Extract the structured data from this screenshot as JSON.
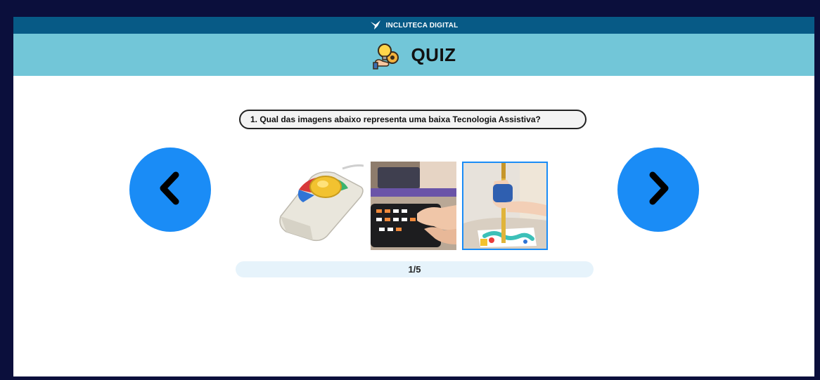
{
  "header": {
    "brand": "INCLUTECA DIGITAL",
    "title": "QUIZ"
  },
  "question": {
    "text": "1. Qual das imagens abaixo representa uma baixa Tecnologia Assistiva?"
  },
  "options": [
    {
      "icon": "trackball-mouse-image"
    },
    {
      "icon": "braille-keyboard-image"
    },
    {
      "icon": "adapted-paintbrush-image"
    }
  ],
  "progress": {
    "text": "1/5",
    "current": 1,
    "total": 5
  },
  "colors": {
    "top_strip": "#075a86",
    "title_bar": "#72c6d8",
    "nav_button": "#1a8cf6",
    "progress_bg": "#e6f3fb"
  }
}
